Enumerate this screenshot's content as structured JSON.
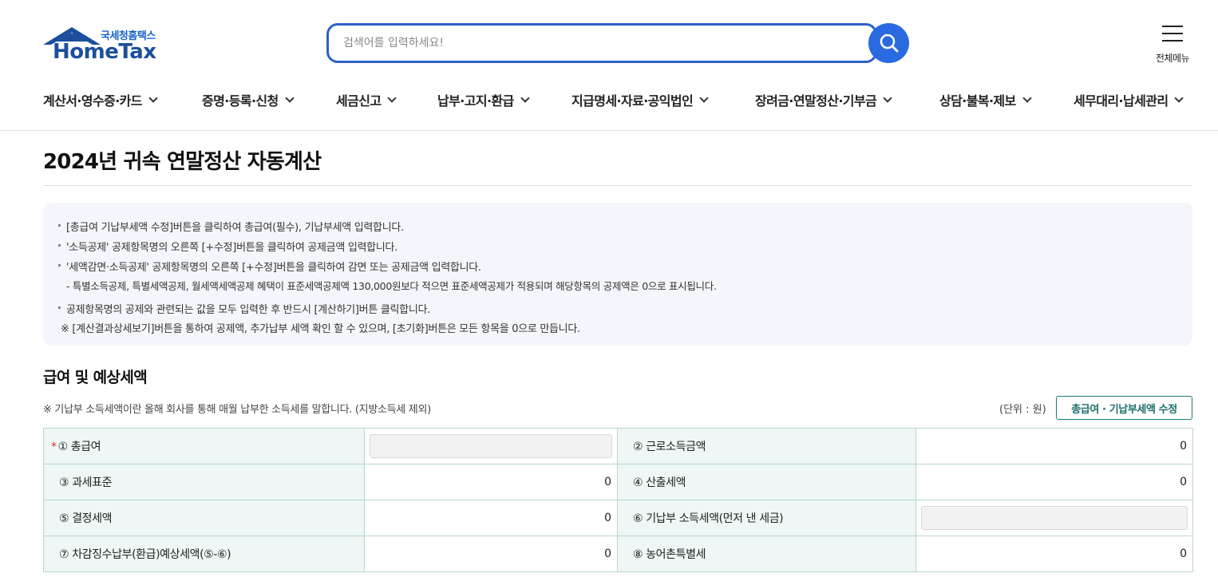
{
  "header": {
    "logo_sub": "국세청홈택스",
    "logo_main": "HomeTax",
    "search_placeholder": "검색어를 입력하세요!",
    "allmenu_label": "전체메뉴"
  },
  "gnb": [
    {
      "label": "계산서·영수증·카드"
    },
    {
      "label": "증명·등록·신청"
    },
    {
      "label": "세금신고"
    },
    {
      "label": "납부·고지·환급"
    },
    {
      "label": "지급명세·자료·공익법인"
    },
    {
      "label": "장려금·연말정산·기부금"
    },
    {
      "label": "상담·불복·제보"
    },
    {
      "label": "세무대리·납세관리"
    }
  ],
  "page_title": "2024년 귀속 연말정산 자동계산",
  "info": [
    "[총급여 기납부세액 수정]버튼을 클릭하여 총급여(필수), 기납부세액 입력합니다.",
    "'소득공제' 공제항목명의 오른쪽 [+수정]버튼을 클릭하여 공제금액 입력합니다.",
    "'세액감면·소득공제' 공제항목명의 오른쪽 [+수정]버튼을 클릭하여 감면 또는 공제금액 입력합니다.",
    "- 특별소득공제, 특별세액공제, 월세액세액공제 혜택이 표준세액공제액 130,000원보다 적으면 표준세액공제가 적용되며 해당항목의 공제액은 0으로 표시됩니다.",
    "공제항목명의 공제와 관련되는 값을 모두 입력한 후 반드시 [계산하기]버튼 클릭합니다.",
    "※ [계산결과상세보기]버튼을 통하여 공제액, 추가납부 세액 확인 할 수 있으며, [초기화]버튼은 모든 항목을 0으로 만듭니다."
  ],
  "section": {
    "title": "급여 및 예상세액",
    "note": "※ 기납부 소득세액이란 올해 회사를 통해 매월 납부한 소득세를 말합니다. (지방소득세 제외)",
    "unit": "(단위 : 원)",
    "edit_button": "총급여 · 기납부세액 수정"
  },
  "table": {
    "required_mark": "*",
    "r1": {
      "l1": "① 총급여",
      "l2": "② 근로소득금액",
      "v2": "0"
    },
    "r2": {
      "l1": "③ 과세표준",
      "v1": "0",
      "l2": "④ 산출세액",
      "v2": "0"
    },
    "r3": {
      "l1": "⑤ 결정세액",
      "v1": "0",
      "l2": "⑥ 기납부 소득세액(먼저 낸 세금)"
    },
    "r4": {
      "l1": "⑦ 차감징수납부(환급)예상세액(⑤-⑥)",
      "v1": "0",
      "l2": "⑧ 농어촌특별세",
      "v2": "0"
    }
  }
}
